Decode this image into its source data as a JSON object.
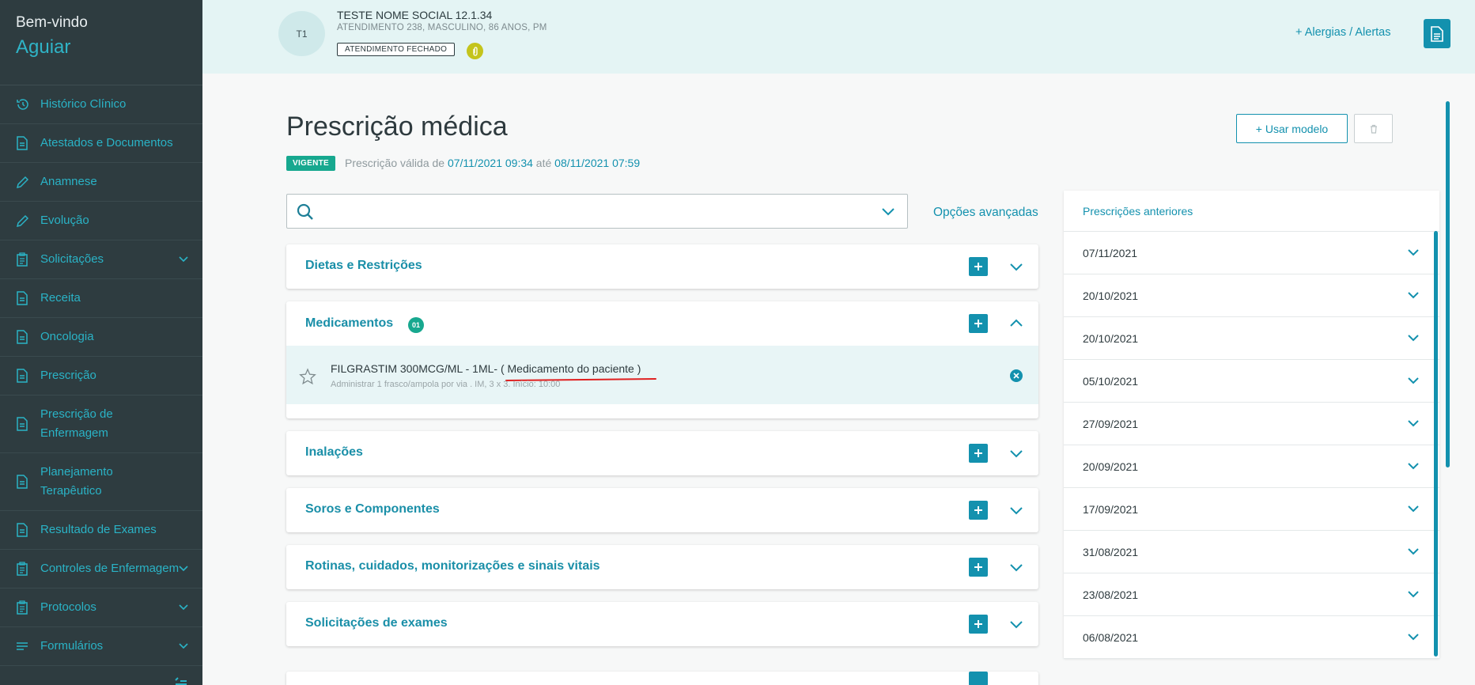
{
  "sidebar": {
    "welcome": "Bem-vindo",
    "user": "Aguiar",
    "items": [
      {
        "label": "Histórico Clínico",
        "icon": "history-icon"
      },
      {
        "label": "Atestados e Documentos",
        "icon": "document-icon"
      },
      {
        "label": "Anamnese",
        "icon": "pencil-icon"
      },
      {
        "label": "Evolução",
        "icon": "pencil-icon"
      },
      {
        "label": "Solicitações",
        "icon": "clipboard-icon",
        "expandable": true
      },
      {
        "label": "Receita",
        "icon": "document-icon"
      },
      {
        "label": "Oncologia",
        "icon": "document-icon"
      },
      {
        "label": "Prescrição",
        "icon": "document-icon"
      },
      {
        "label": "Prescrição de Enfermagem",
        "icon": "document-icon"
      },
      {
        "label": "Planejamento Terapêutico",
        "icon": "document-icon"
      },
      {
        "label": "Resultado de Exames",
        "icon": "document-icon"
      },
      {
        "label": "Controles de Enfermagem",
        "icon": "clipboard-icon",
        "expandable": true
      },
      {
        "label": "Protocolos",
        "icon": "clipboard-icon",
        "expandable": true
      },
      {
        "label": "Formulários",
        "icon": "list-icon",
        "expandable": true
      }
    ]
  },
  "header": {
    "avatar_initials": "T1",
    "patient_name": "TESTE NOME SOCIAL 12.1.34",
    "patient_info": "ATENDIMENTO 238, MASCULINO, 86 ANOS, PM",
    "status_badge": "ATENDIMENTO FECHADO",
    "alerts_link": "+  Alergias / Alertas"
  },
  "main": {
    "title": "Prescrição médica",
    "status": "VIGENTE",
    "validity_prefix": "Prescrição válida de",
    "validity_start": "07/11/2021 09:34",
    "validity_mid": "até",
    "validity_end": "08/11/2021 07:59",
    "use_model_button": "+  Usar modelo",
    "search_placeholder": "",
    "advanced_options": "Opções avançadas",
    "sections": {
      "dietas": "Dietas e Restrições",
      "medicamentos": "Medicamentos",
      "medicamentos_count": "01",
      "inalacoes": "Inalações",
      "soros": "Soros e Componentes",
      "rotinas": "Rotinas, cuidados, monitorizações e sinais vitais",
      "exames": "Solicitações de exames"
    },
    "medication": {
      "name": "FILGRASTIM 300MCG/ML - 1ML- ( Medicamento do paciente )",
      "description": "Administrar 1 frasco/ampola por via . IM, 3 x 3. Início: 10:00"
    }
  },
  "previous": {
    "title": "Prescrições anteriores",
    "dates": [
      "07/11/2021",
      "20/10/2021",
      "20/10/2021",
      "05/10/2021",
      "27/09/2021",
      "20/09/2021",
      "17/09/2021",
      "31/08/2021",
      "23/08/2021",
      "06/08/2021"
    ]
  },
  "colors": {
    "accent": "#1391ae",
    "sidebar_bg": "#2e3c40",
    "header_bg": "#e4f4f4",
    "success": "#17a88f",
    "highlight_underline": "#e02020"
  }
}
